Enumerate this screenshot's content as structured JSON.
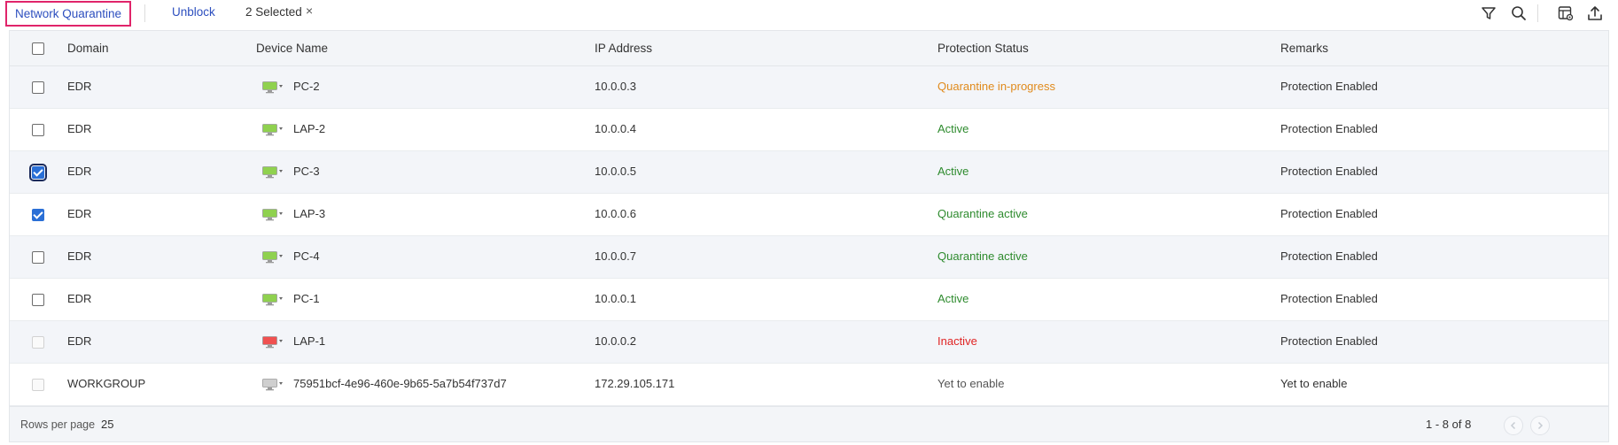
{
  "toolbar": {
    "network_quarantine_label": "Network Quarantine",
    "unblock_label": "Unblock",
    "selected_label": "2 Selected",
    "clear_icon": "×",
    "icons": [
      "filter-icon",
      "search-icon",
      "column-settings-icon",
      "export-icon"
    ]
  },
  "table": {
    "columns": {
      "domain": "Domain",
      "device_name": "Device Name",
      "ip_address": "IP Address",
      "protection_status": "Protection Status",
      "remarks": "Remarks"
    },
    "rows": [
      {
        "domain": "EDR",
        "device": "PC-2",
        "ip": "10.0.0.3",
        "status": "Quarantine in-progress",
        "remarks": "Protection Enabled",
        "checkbox": "unchecked",
        "device_icon_color": "#8fd14f",
        "status_color": "orange"
      },
      {
        "domain": "EDR",
        "device": "LAP-2",
        "ip": "10.0.0.4",
        "status": "Active",
        "remarks": "Protection Enabled",
        "checkbox": "unchecked",
        "device_icon_color": "#8fd14f",
        "status_color": "green"
      },
      {
        "domain": "EDR",
        "device": "PC-3",
        "ip": "10.0.0.5",
        "status": "Active",
        "remarks": "Protection Enabled",
        "checkbox": "checked-focused",
        "device_icon_color": "#8fd14f",
        "status_color": "green"
      },
      {
        "domain": "EDR",
        "device": "LAP-3",
        "ip": "10.0.0.6",
        "status": "Quarantine active",
        "remarks": "Protection Enabled",
        "checkbox": "checked",
        "device_icon_color": "#8fd14f",
        "status_color": "green"
      },
      {
        "domain": "EDR",
        "device": "PC-4",
        "ip": "10.0.0.7",
        "status": "Quarantine active",
        "remarks": "Protection Enabled",
        "checkbox": "unchecked",
        "device_icon_color": "#8fd14f",
        "status_color": "green"
      },
      {
        "domain": "EDR",
        "device": "PC-1",
        "ip": "10.0.0.1",
        "status": "Active",
        "remarks": "Protection Enabled",
        "checkbox": "unchecked",
        "device_icon_color": "#8fd14f",
        "status_color": "green"
      },
      {
        "domain": "EDR",
        "device": "LAP-1",
        "ip": "10.0.0.2",
        "status": "Inactive",
        "remarks": "Protection Enabled",
        "checkbox": "disabled",
        "device_icon_color": "#f05050",
        "status_color": "red"
      },
      {
        "domain": "WORKGROUP",
        "device": "75951bcf-4e96-460e-9b65-5a7b54f737d7",
        "ip": "172.29.105.171",
        "status": "Yet to enable",
        "remarks": "Yet to enable",
        "checkbox": "disabled",
        "device_icon_color": "#cfcfcf",
        "status_color": "gray"
      }
    ]
  },
  "footer": {
    "rows_per_page_label": "Rows per page",
    "rows_per_page_value": "25",
    "page_info": "1 - 8 of 8"
  },
  "colors": {
    "accent_blue": "#2d4fbf",
    "highlight_border": "#e0246a",
    "status_green": "#2e8b2e",
    "status_orange": "#e08a1c",
    "status_red": "#e02424"
  }
}
